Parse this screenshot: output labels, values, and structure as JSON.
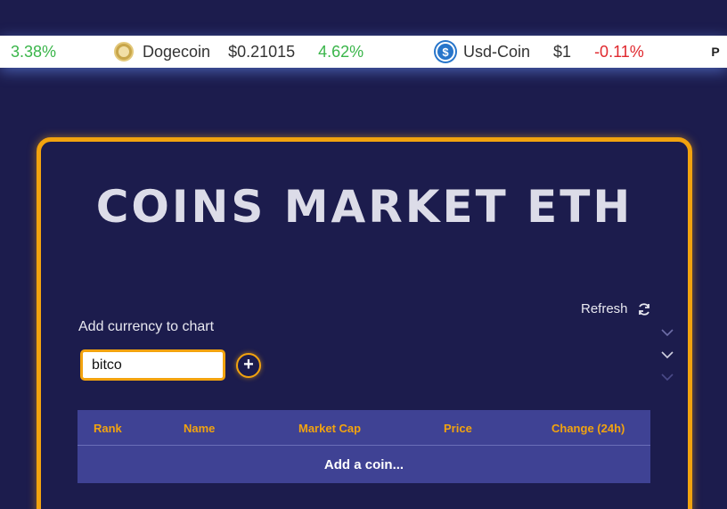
{
  "ticker": {
    "items": [
      {
        "change": "3.38%",
        "change_dir": "up"
      },
      {
        "name": "Dogecoin",
        "icon": "dogecoin-icon",
        "price": "$0.21015",
        "change": "4.62%",
        "change_dir": "up"
      },
      {
        "name": "Usd-Coin",
        "icon": "usd-coin-icon",
        "price": "$1",
        "change": "-0.11%",
        "change_dir": "down"
      },
      {
        "icon": "polkadot-icon"
      }
    ]
  },
  "main": {
    "title": "COINS MARKET ETH",
    "refresh_label": "Refresh",
    "add_label": "Add currency to chart",
    "search_value": "bitco",
    "table": {
      "headers": [
        "Rank",
        "Name",
        "Market Cap",
        "Price",
        "Change (24h)"
      ],
      "empty_text": "Add a coin..."
    }
  },
  "colors": {
    "background": "#1c1c4d",
    "accent": "#f2a30f",
    "table_bg": "#3f4294",
    "positive": "#3ab54a",
    "negative": "#e0282e"
  }
}
